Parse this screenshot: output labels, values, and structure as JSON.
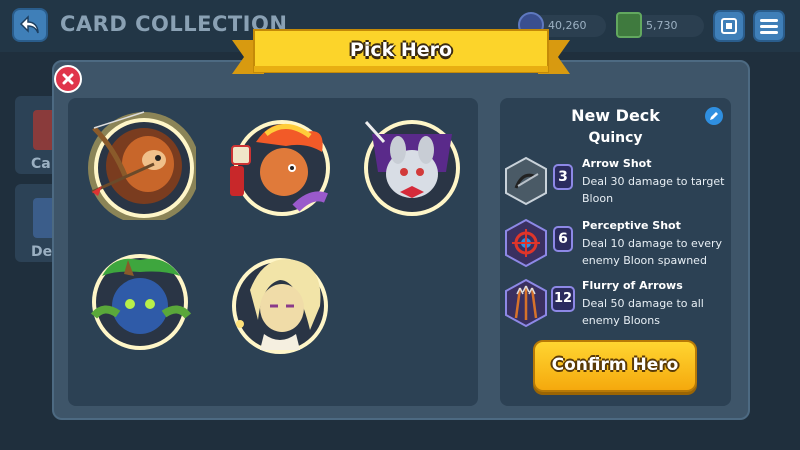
{
  "header": {
    "title": "CARD COLLECTION",
    "back_icon": "back-arrow-icon",
    "currencies": [
      {
        "name": "gems",
        "icon": "monkey-money-icon",
        "value": "40,260"
      },
      {
        "name": "cash",
        "icon": "cash-icon",
        "value": "5,730"
      }
    ],
    "collection_icon": "card-collection-icon",
    "menu_icon": "hamburger-menu-icon"
  },
  "side_tabs": [
    {
      "label": "Ca"
    },
    {
      "label": "De"
    }
  ],
  "modal": {
    "title": "Pick Hero",
    "close_icon": "close-icon",
    "selected_hero": "quincy",
    "heroes": [
      {
        "id": "quincy",
        "icon": "hero-quincy-portrait",
        "selected": true
      },
      {
        "id": "gwendolin",
        "icon": "hero-gwendolin-portrait",
        "selected": false
      },
      {
        "id": "ezili",
        "icon": "hero-ezili-portrait",
        "selected": false
      },
      {
        "id": "obyn",
        "icon": "hero-obyn-portrait",
        "selected": false
      },
      {
        "id": "adora",
        "icon": "hero-adora-portrait",
        "selected": false
      }
    ],
    "deck": {
      "name": "New Deck",
      "hero_name": "Quincy",
      "edit_icon": "pencil-icon",
      "cards": [
        {
          "title": "Arrow Shot",
          "cost": "3",
          "description": "Deal 30 damage to target Bloon",
          "icon": "arrow-shot-icon"
        },
        {
          "title": "Perceptive Shot",
          "cost": "6",
          "description": "Deal 10 damage to every enemy Bloon spawned",
          "icon": "perceptive-shot-icon"
        },
        {
          "title": "Flurry of Arrows",
          "cost": "12",
          "description": "Deal 50 damage to all enemy Bloons",
          "icon": "flurry-of-arrows-icon"
        }
      ]
    },
    "confirm_label": "Confirm Hero"
  },
  "colors": {
    "accent_yellow": "#f5b81a",
    "close_red": "#e0354b",
    "panel_dark": "#2c4154",
    "modal_bg": "#3e5569",
    "cost_border": "#8d88e6"
  }
}
